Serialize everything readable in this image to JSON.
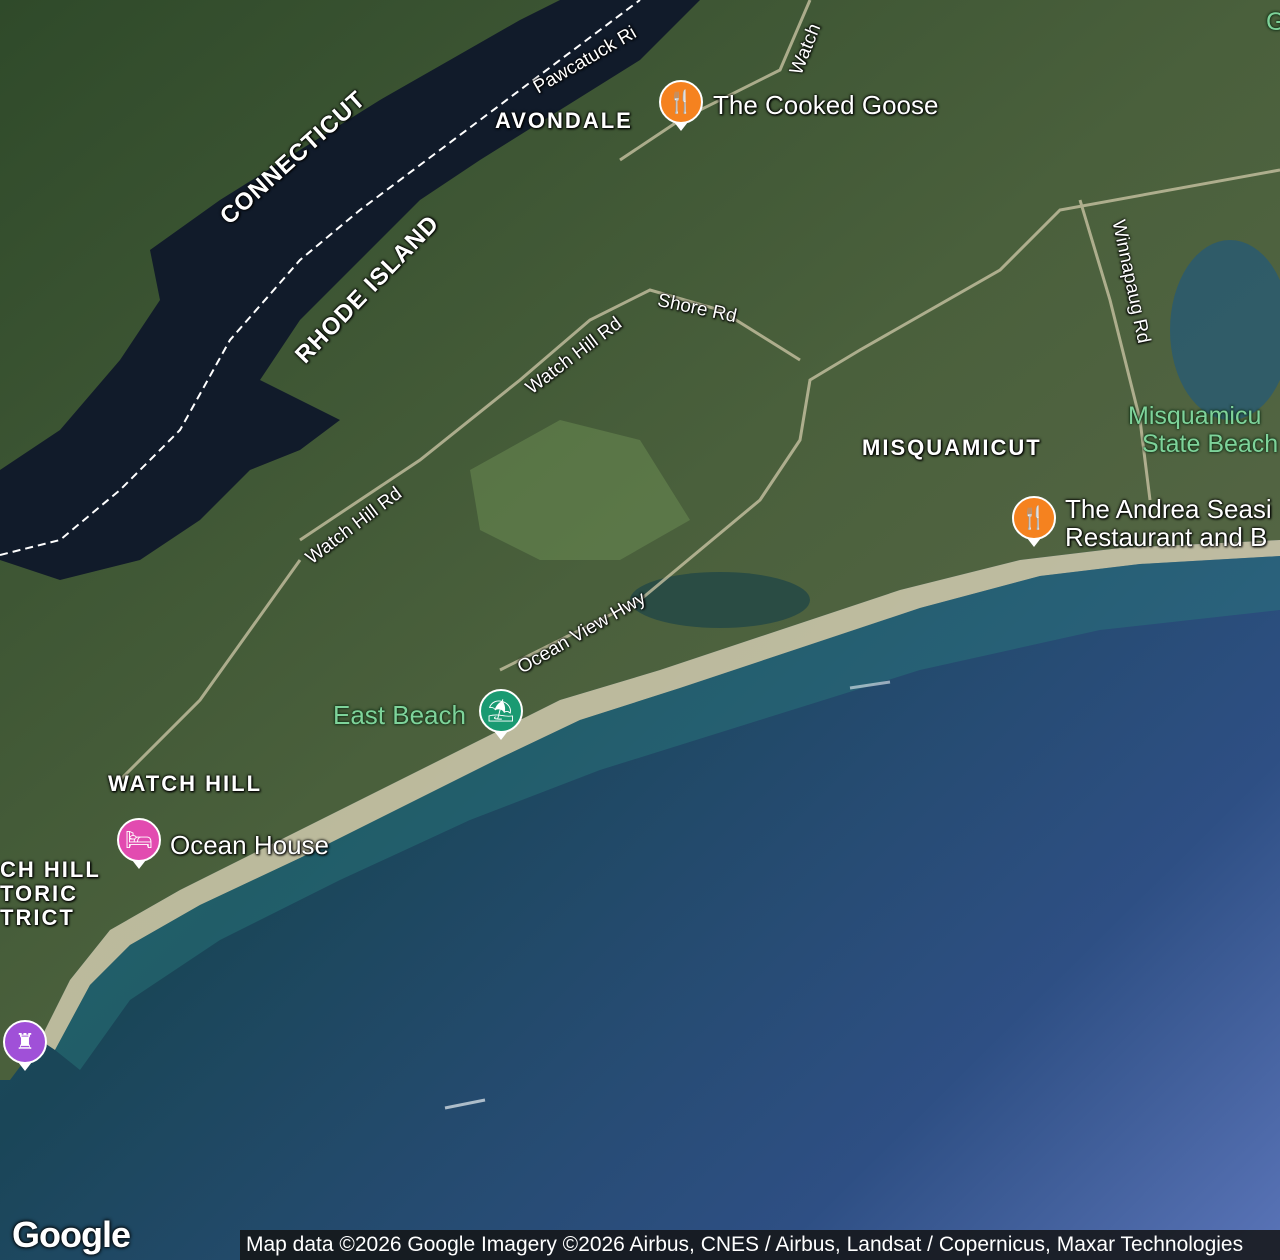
{
  "colors": {
    "ocean_deep": "#1d4a60",
    "ocean_far": "#4a6aa8",
    "land": "#3e5a34",
    "river": "#101c2c",
    "beach": "#d8cfa8",
    "restaurant_pin": "#f5821f",
    "beach_pin": "#1a9a72",
    "hotel_pin": "#e24bb0",
    "landmark_pin": "#a050d8",
    "park_text": "#7ed39a"
  },
  "places": {
    "avondale": "AVONDALE",
    "misquamicut": "MISQUAMICUT",
    "watch_hill": "WATCH HILL",
    "historic_district_l1": "CH HILL",
    "historic_district_l2": "TORIC",
    "historic_district_l3": "TRICT"
  },
  "states": {
    "connecticut": "CONNECTICUT",
    "rhode_island": "RHODE ISLAND"
  },
  "roads": {
    "pawcatuck": "Pawcatuck Ri",
    "watch_hill_top": "Watch",
    "shore_rd": "Shore Rd",
    "winnapaug": "Winnapaug Rd",
    "watch_hill_rd_1": "Watch Hill Rd",
    "watch_hill_rd_2": "Watch Hill Rd",
    "ocean_view_hwy": "Ocean View Hwy"
  },
  "pois": {
    "cooked_goose": {
      "label": "The Cooked Goose",
      "icon": "fork-knife-icon"
    },
    "andrea_l1": "The Andrea Seasi",
    "andrea_l2": "Restaurant and B",
    "andrea_icon": "fork-knife-icon",
    "east_beach": {
      "label": "East Beach",
      "icon": "umbrella-icon"
    },
    "ocean_house": {
      "label": "Ocean House",
      "icon": "bed-icon"
    },
    "landmark_icon": "castle-icon"
  },
  "parks": {
    "misquamicut_sb_l1": "Misquamicu",
    "misquamicut_sb_l2": "State Beach",
    "corner_g": "G"
  },
  "branding": {
    "logo": "Google"
  },
  "attribution": "Map data ©2026 Google Imagery ©2026 Airbus, CNES / Airbus, Landsat / Copernicus, Maxar Technologies"
}
